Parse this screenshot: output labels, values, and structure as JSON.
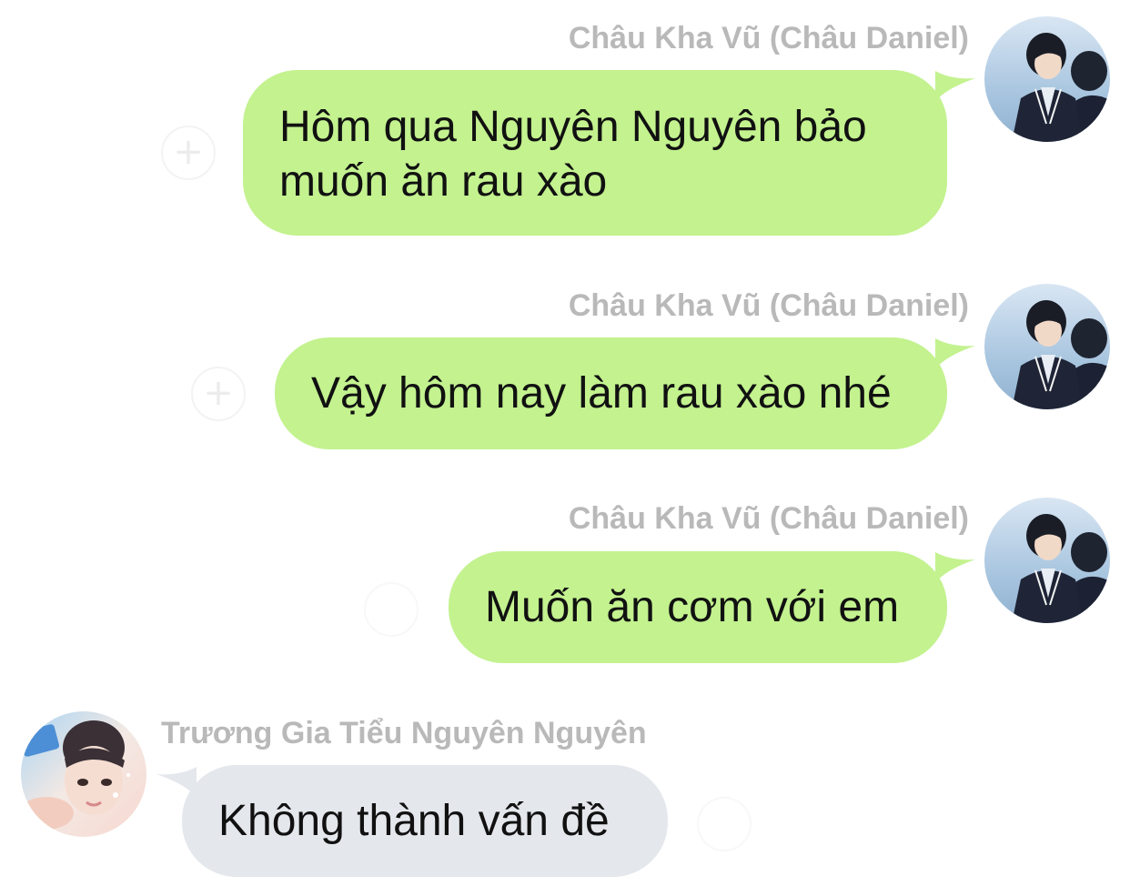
{
  "messages": [
    {
      "sender": "Châu Kha Vũ (Châu Daniel)",
      "text": "Hôm qua Nguyên Nguyên bảo muốn ăn rau xào",
      "direction": "outgoing"
    },
    {
      "sender": "Châu Kha Vũ (Châu Daniel)",
      "text": "Vậy hôm nay làm rau xào nhé",
      "direction": "outgoing"
    },
    {
      "sender": "Châu Kha Vũ (Châu Daniel)",
      "text": "Muốn ăn cơm với em",
      "direction": "outgoing"
    },
    {
      "sender": "Trương Gia Tiểu Nguyên Nguyên",
      "text": "Không thành vấn đề",
      "direction": "incoming"
    }
  ],
  "icons": {
    "add_reaction": "plus-circle-icon",
    "avatar_outgoing": "avatar-photo",
    "avatar_incoming": "avatar-photo"
  },
  "colors": {
    "outgoing_bubble": "#c3f28f",
    "incoming_bubble": "#e4e7ec",
    "sender_name": "#b9b9b9",
    "message_text": "#111111"
  }
}
